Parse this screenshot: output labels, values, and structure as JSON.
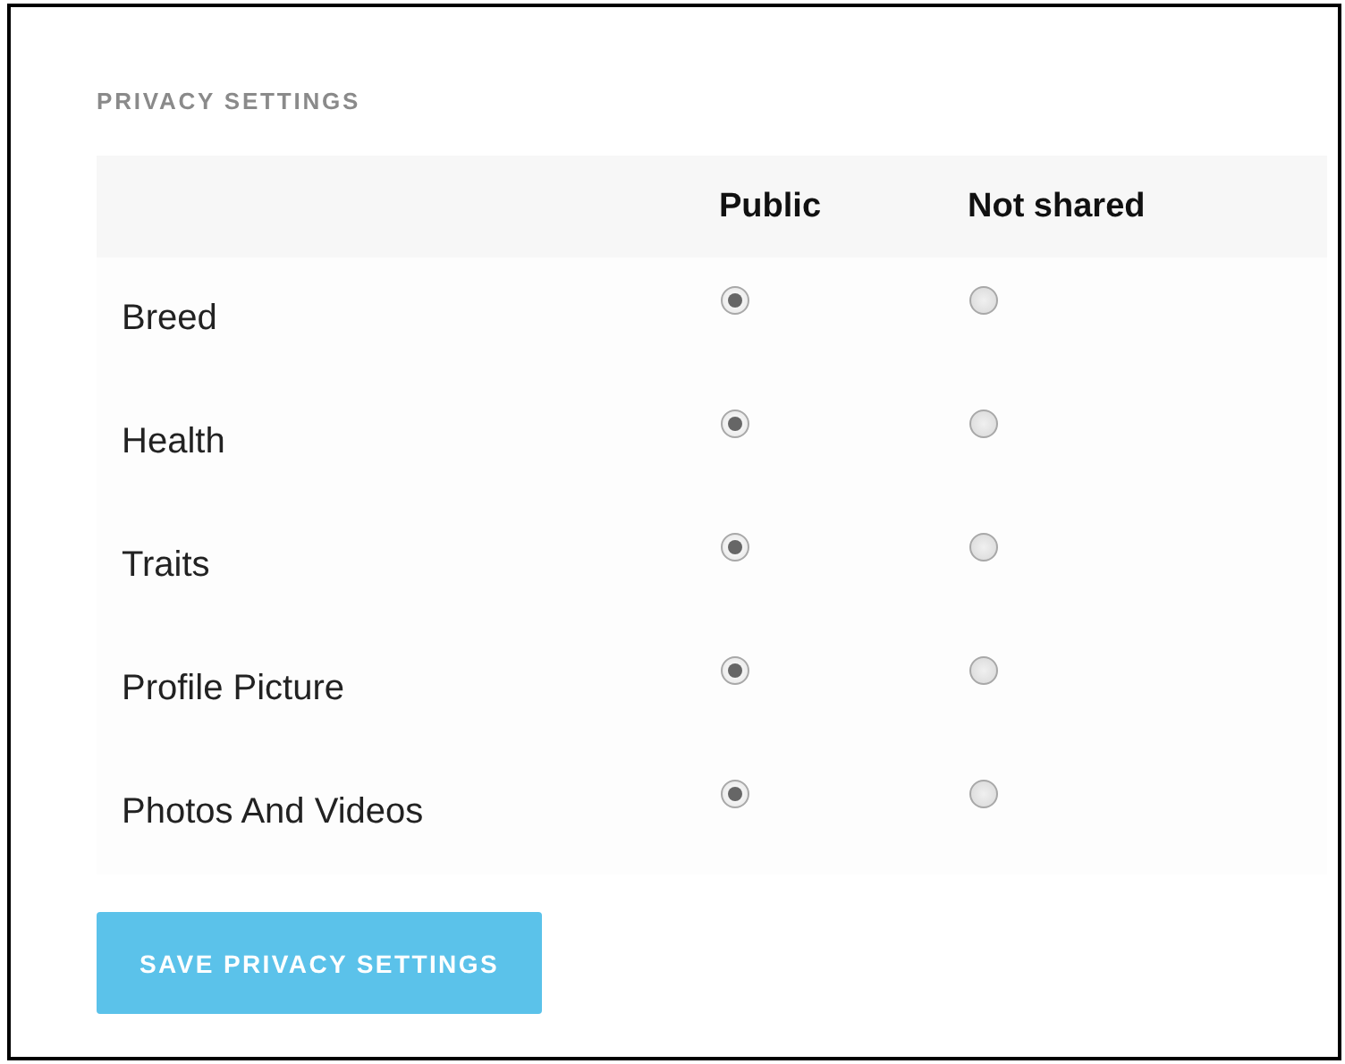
{
  "heading": "PRIVACY SETTINGS",
  "columns": [
    "Public",
    "Not shared"
  ],
  "rows": [
    {
      "label": "Breed",
      "options": [
        {
          "selected": true
        },
        {
          "selected": false
        }
      ]
    },
    {
      "label": "Health",
      "options": [
        {
          "selected": true
        },
        {
          "selected": false
        }
      ]
    },
    {
      "label": "Traits",
      "options": [
        {
          "selected": true
        },
        {
          "selected": false
        }
      ]
    },
    {
      "label": "Profile Picture",
      "options": [
        {
          "selected": true
        },
        {
          "selected": false
        }
      ]
    },
    {
      "label": "Photos And Videos",
      "options": [
        {
          "selected": true
        },
        {
          "selected": false
        }
      ]
    }
  ],
  "button": "SAVE PRIVACY SETTINGS"
}
